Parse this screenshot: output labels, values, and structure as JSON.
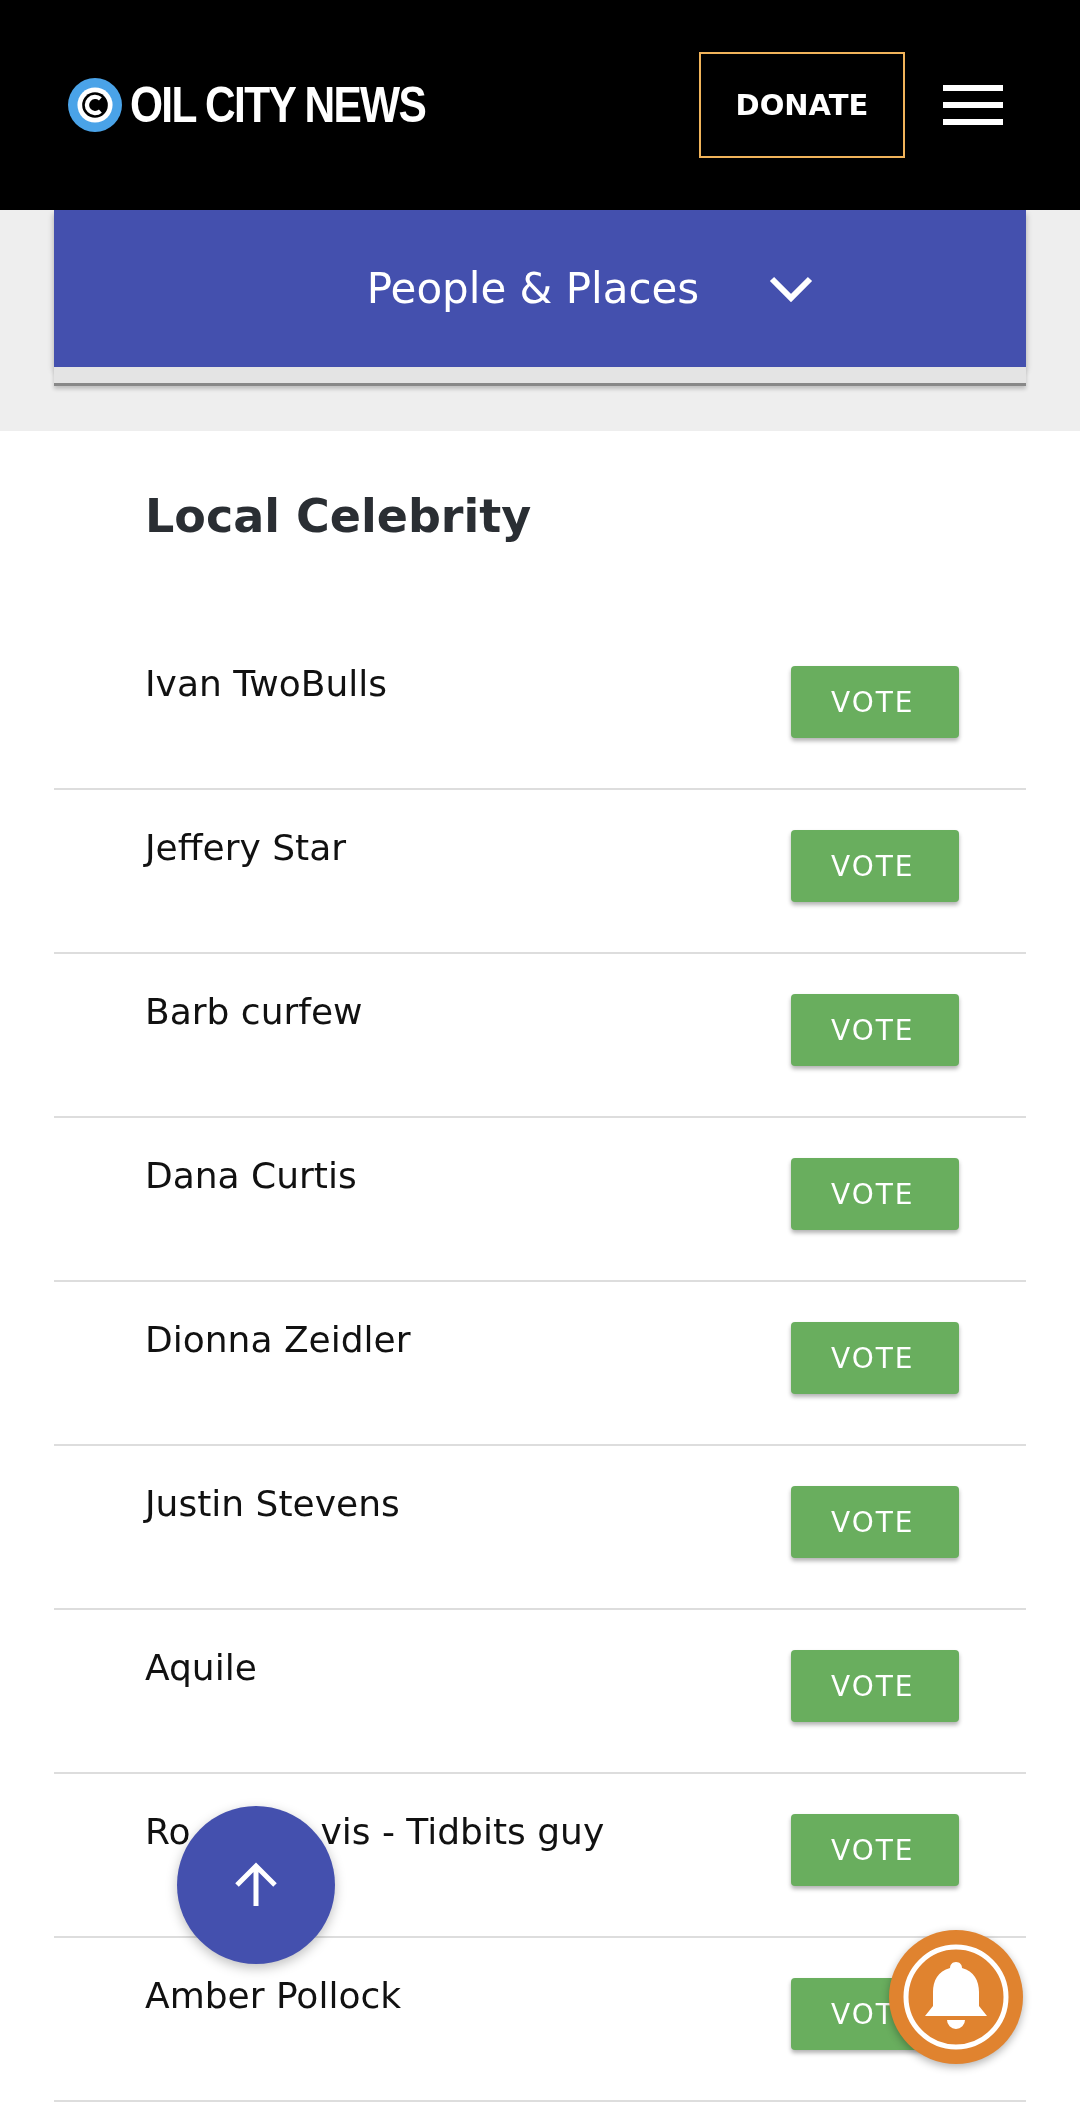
{
  "header": {
    "logo": "OIL CITY NEWS",
    "donate": "DONATE"
  },
  "category": {
    "label": "People & Places",
    "expanded": false
  },
  "card": {
    "title": "Local Celebrity",
    "nominees": [
      {
        "name": "Ivan TwoBulls",
        "vote": "VOTE"
      },
      {
        "name": "Jeffery Star",
        "vote": "VOTE"
      },
      {
        "name": "Barb curfew",
        "vote": "VOTE"
      },
      {
        "name": "Dana Curtis",
        "vote": "VOTE"
      },
      {
        "name": "Dionna Zeidler",
        "vote": "VOTE"
      },
      {
        "name": "Justin Stevens",
        "vote": "VOTE"
      },
      {
        "name": "Aquile",
        "vote": "VOTE"
      },
      {
        "name": "Ro",
        "name_after_cover": "vis - Tidbits guy",
        "vote": "VOTE"
      },
      {
        "name": "Amber Pollock",
        "vote": "VOT"
      }
    ]
  }
}
